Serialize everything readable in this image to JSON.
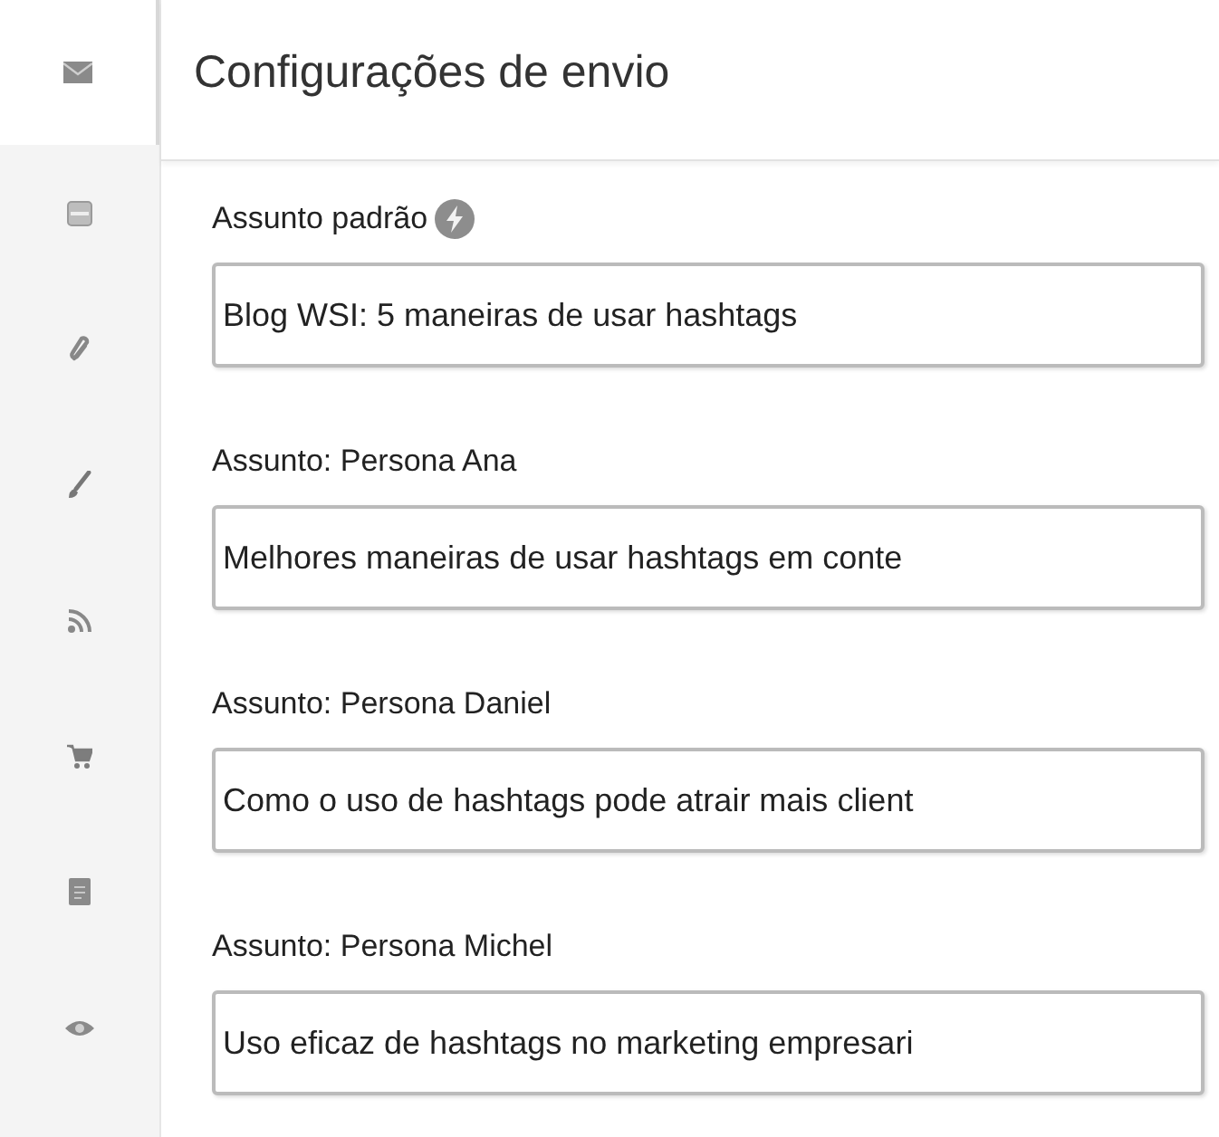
{
  "sidebar": {
    "items": [
      {
        "kind": "envelope",
        "selected": true
      },
      {
        "kind": "tray",
        "selected": false
      },
      {
        "kind": "paperclip",
        "selected": false
      },
      {
        "kind": "brush",
        "selected": false
      },
      {
        "kind": "rss",
        "selected": false
      },
      {
        "kind": "cart",
        "selected": false
      },
      {
        "kind": "document",
        "selected": false
      },
      {
        "kind": "eye",
        "selected": false
      }
    ]
  },
  "title": "Configurações de envio",
  "fields": [
    {
      "label": "Assunto padrão",
      "hint_icon": true,
      "value": "Blog WSI: 5 maneiras de usar hashtags"
    },
    {
      "label": "Assunto: Persona Ana",
      "hint_icon": false,
      "value": "Melhores maneiras de usar hashtags em conte"
    },
    {
      "label": "Assunto: Persona Daniel",
      "hint_icon": false,
      "value": "Como o uso de hashtags pode atrair mais client"
    },
    {
      "label": "Assunto: Persona Michel",
      "hint_icon": false,
      "value": "Uso eficaz de hashtags no marketing empresari"
    }
  ]
}
